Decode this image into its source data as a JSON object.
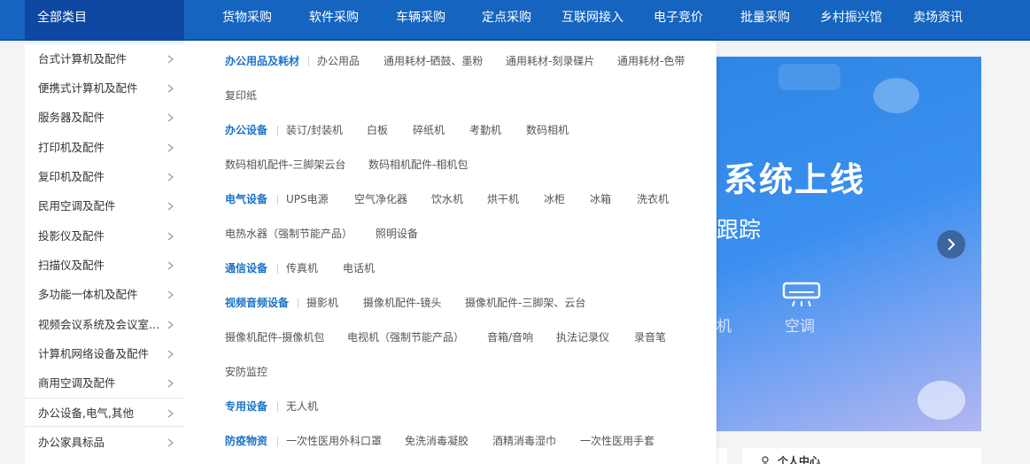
{
  "nav": {
    "all_categories": "全部类目",
    "links": [
      "货物采购",
      "软件采购",
      "车辆采购",
      "定点采购",
      "互联网接入",
      "电子竞价",
      "批量采购",
      "乡村振兴馆",
      "卖场资讯"
    ]
  },
  "sidebar": {
    "items": [
      "台式计算机及配件",
      "便携式计算机及配件",
      "服务器及配件",
      "打印机及配件",
      "复印机及配件",
      "民用空调及配件",
      "投影仪及配件",
      "扫描仪及配件",
      "多功能一体机及配件",
      "视频会议系统及会议室音响...",
      "计算机网络设备及配件",
      "商用空调及配件",
      "办公设备,电气,其他",
      "办公家具标品"
    ],
    "active_index": 12
  },
  "flyout": {
    "groups": [
      {
        "title": "办公用品及耗材",
        "items": [
          "办公用品",
          "通用耗材-硒鼓、墨粉",
          "通用耗材-刻录碟片",
          "通用耗材-色带",
          "复印纸"
        ]
      },
      {
        "title": "办公设备",
        "items": [
          "装订/封装机",
          "白板",
          "碎纸机",
          "考勤机",
          "数码相机",
          "数码相机配件-三脚架云台",
          "数码相机配件-相机包"
        ]
      },
      {
        "title": "电气设备",
        "items": [
          "UPS电源",
          "空气净化器",
          "饮水机",
          "烘干机",
          "冰柜",
          "冰箱",
          "洗衣机",
          "电热水器（强制节能产品）",
          "照明设备"
        ]
      },
      {
        "title": "通信设备",
        "items": [
          "传真机",
          "电话机"
        ]
      },
      {
        "title": "视频音频设备",
        "items": [
          "摄影机",
          "摄像机配件-镜头",
          "摄像机配件-三脚架、云台",
          "摄像机配件-摄像机包",
          "电视机（强制节能产品）",
          "音箱/音响",
          "执法记录仪",
          "录音笔",
          "安防监控"
        ]
      },
      {
        "title": "专用设备",
        "items": [
          "无人机"
        ]
      },
      {
        "title": "防疫物资",
        "items": [
          "一次性医用外科口罩",
          "免洗消毒凝胶",
          "酒精消毒湿巾",
          "一次性医用手套"
        ]
      }
    ]
  },
  "banner": {
    "title": "系统上线",
    "subtitle": "跟踪",
    "icon_label_left": "机",
    "icon_label_right": "空调",
    "colors": {
      "from": "#2f86e4",
      "to": "#b4b8f0"
    }
  },
  "personal": {
    "title": "个人中心"
  },
  "colors": {
    "nav_bg": "#1565c0",
    "nav_active_bg": "#0d47a1",
    "group_title": "#1a73c7"
  }
}
